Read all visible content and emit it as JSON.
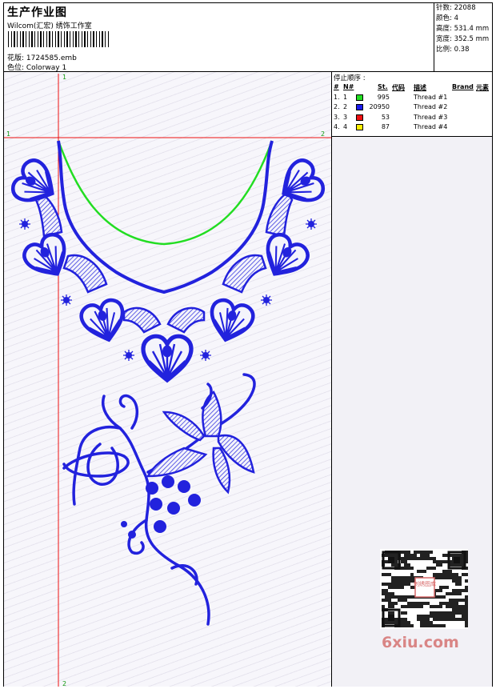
{
  "header": {
    "title": "生产作业图",
    "company": "Wilcom(汇宏) 绣饰工作室",
    "design_file": "花版: 1724585.emb",
    "colorway": "色位: Colorway 1"
  },
  "stats": {
    "stitches": "针数: 22088",
    "colors": "颜色: 4",
    "height": "高度: 531.4 mm",
    "width": "宽度: 352.5 mm",
    "scale": "比例: 0.38"
  },
  "sequence": {
    "title": "停止顺序 :",
    "headers": {
      "num": "#",
      "n": "N#",
      "st": "St.",
      "code": "代码",
      "desc": "描述",
      "brand": "Brand",
      "element": "元素"
    },
    "rows": [
      {
        "num": "1.",
        "n": "1",
        "color": "#22dd22",
        "st": "995",
        "desc": "Thread #1"
      },
      {
        "num": "2.",
        "n": "2",
        "color": "#1a1aee",
        "st": "20950",
        "desc": "Thread #2"
      },
      {
        "num": "3.",
        "n": "3",
        "color": "#ee1111",
        "st": "53",
        "desc": "Thread #3"
      },
      {
        "num": "4.",
        "n": "4",
        "color": "#ffee00",
        "st": "87",
        "desc": "Thread #4"
      }
    ]
  },
  "guides": {
    "v_top": "1",
    "v_bottom": "2",
    "h_left": "1",
    "h_right": "2"
  },
  "colors": {
    "embroidery": "#2222dd",
    "neckline": "#22dd22",
    "guide": "#ee1111"
  },
  "watermark": {
    "logo": "6xiu.com",
    "stamp": "刺绣图库"
  }
}
